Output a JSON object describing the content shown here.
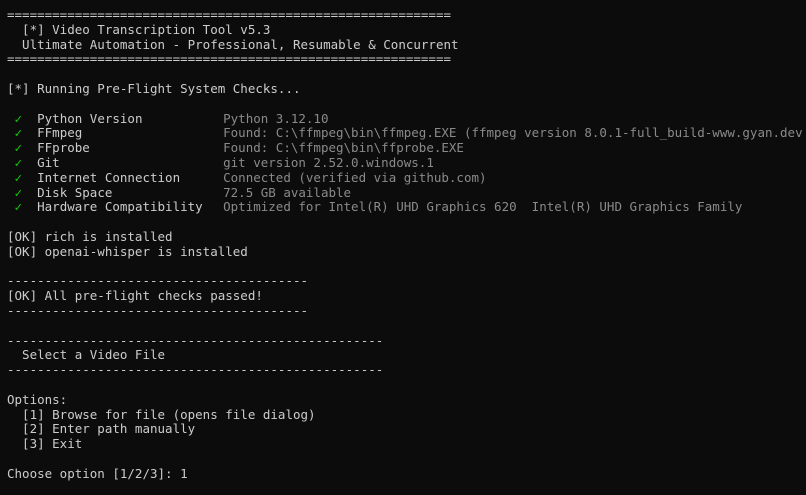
{
  "header": {
    "rule": "===========================================================",
    "title": "  [*] Video Transcription Tool v5.3",
    "subtitle": "  Ultimate Automation - Professional, Resumable & Concurrent"
  },
  "preflight": {
    "heading": "[*] Running Pre-Flight System Checks...",
    "check_mark": "✓",
    "checks": [
      {
        "label": "Python Version",
        "value": "Python 3.12.10"
      },
      {
        "label": "FFmpeg",
        "value": "Found: C:\\ffmpeg\\bin\\ffmpeg.EXE (ffmpeg version 8.0.1-full_build-www.gyan.dev"
      },
      {
        "label": "FFprobe",
        "value": "Found: C:\\ffmpeg\\bin\\ffprobe.EXE"
      },
      {
        "label": "Git",
        "value": "git version 2.52.0.windows.1"
      },
      {
        "label": "Internet Connection",
        "value": "Connected (verified via github.com)"
      },
      {
        "label": "Disk Space",
        "value": "72.5 GB available"
      },
      {
        "label": "Hardware Compatibility",
        "value": "Optimized for Intel(R) UHD Graphics 620  Intel(R) UHD Graphics Family"
      }
    ]
  },
  "packages": [
    "[OK] rich is installed",
    "[OK] openai-whisper is installed"
  ],
  "result": {
    "rule": "----------------------------------------",
    "message": "[OK] All pre-flight checks passed!"
  },
  "select": {
    "rule": "--------------------------------------------------",
    "title": "  Select a Video File"
  },
  "options": {
    "heading": "Options:",
    "items": [
      "  [1] Browse for file (opens file dialog)",
      "  [2] Enter path manually",
      "  [3] Exit"
    ]
  },
  "prompt": {
    "text": "Choose option [1/2/3]: ",
    "value": "1"
  }
}
